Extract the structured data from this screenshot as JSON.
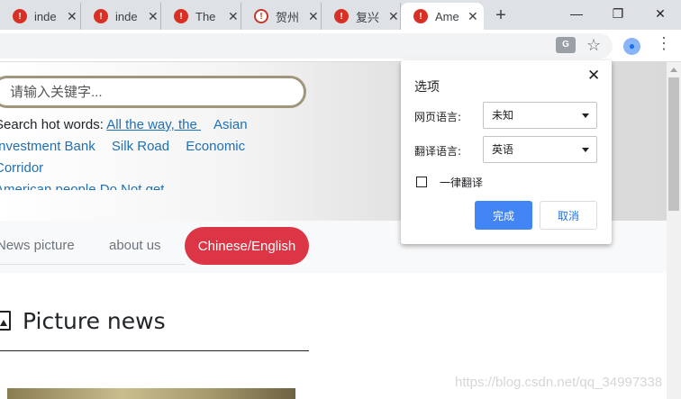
{
  "browser": {
    "tabs": [
      {
        "title": "inde",
        "close": "✕",
        "active": false
      },
      {
        "title": "inde",
        "close": "✕",
        "active": false
      },
      {
        "title": "The",
        "close": "✕",
        "active": false
      },
      {
        "title": "贺州",
        "close": "✕",
        "active": false
      },
      {
        "title": "复兴",
        "close": "✕",
        "active": false
      },
      {
        "title": "Ame",
        "close": "✕",
        "active": true
      }
    ],
    "new_tab": "+",
    "window_controls": {
      "minimize": "—",
      "maximize": "❐",
      "close": "✕"
    },
    "toolbar": {
      "translate_icon": "translate-icon",
      "star": "☆",
      "menu": "⋮"
    }
  },
  "page": {
    "search": {
      "placeholder": "请输入关键字..."
    },
    "hot_words": {
      "label": "Search hot words: ",
      "items": [
        "All the way, the ",
        "Asian Investment Bank",
        "Silk Road",
        "Economic Corridor"
      ],
      "truncated": "American people Do Not get"
    },
    "nav": {
      "items": [
        "News picture",
        "about us"
      ],
      "lang_button": "Chinese/English"
    },
    "section": {
      "title": "Picture news"
    },
    "watermark": "https://blog.csdn.net/qq_34997338"
  },
  "translate_popup": {
    "title": "选项",
    "close": "✕",
    "page_language_label": "网页语言:",
    "page_language_value": "未知",
    "target_language_label": "翻译语言:",
    "target_language_value": "英语",
    "always_translate_label": "一律翻译",
    "always_translate_checked": false,
    "done_label": "完成",
    "cancel_label": "取消"
  },
  "colors": {
    "accent_blue": "#4285f4",
    "danger_red": "#dc3545",
    "link_blue": "#1f6fb5",
    "search_border": "#a0967c"
  }
}
